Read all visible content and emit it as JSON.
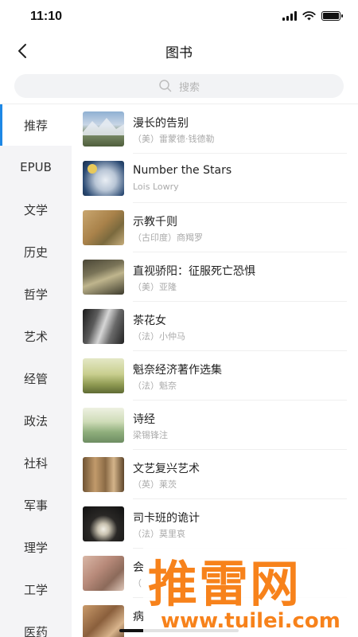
{
  "status": {
    "time": "11:10"
  },
  "nav": {
    "title": "图书"
  },
  "search": {
    "placeholder": "搜索"
  },
  "sidebar": {
    "items": [
      {
        "label": "推荐"
      },
      {
        "label": "EPUB"
      },
      {
        "label": "文学"
      },
      {
        "label": "历史"
      },
      {
        "label": "哲学"
      },
      {
        "label": "艺术"
      },
      {
        "label": "经管"
      },
      {
        "label": "政法"
      },
      {
        "label": "社科"
      },
      {
        "label": "军事"
      },
      {
        "label": "理学"
      },
      {
        "label": "工学"
      },
      {
        "label": "医药"
      }
    ]
  },
  "books": [
    {
      "title": "漫长的告别",
      "author": "（美）雷蒙德·钱德勒"
    },
    {
      "title": "Number the Stars",
      "author": "Lois Lowry"
    },
    {
      "title": "示教千则",
      "author": "（古印度）商羯罗"
    },
    {
      "title": "直视骄阳：征服死亡恐惧",
      "author": "（美）亚隆"
    },
    {
      "title": "茶花女",
      "author": "（法）小仲马"
    },
    {
      "title": "魁奈经济著作选集",
      "author": "（法）魁奈"
    },
    {
      "title": "诗经",
      "author": "梁锡锋注"
    },
    {
      "title": "文艺复兴艺术",
      "author": "（英）莱茨"
    },
    {
      "title": "司卡班的诡计",
      "author": "（法）莫里哀"
    },
    {
      "title": "会",
      "author": "（"
    },
    {
      "title": "病",
      "author": ""
    }
  ],
  "watermark": {
    "big": "推雷网",
    "small": "www.tuilei.com"
  }
}
